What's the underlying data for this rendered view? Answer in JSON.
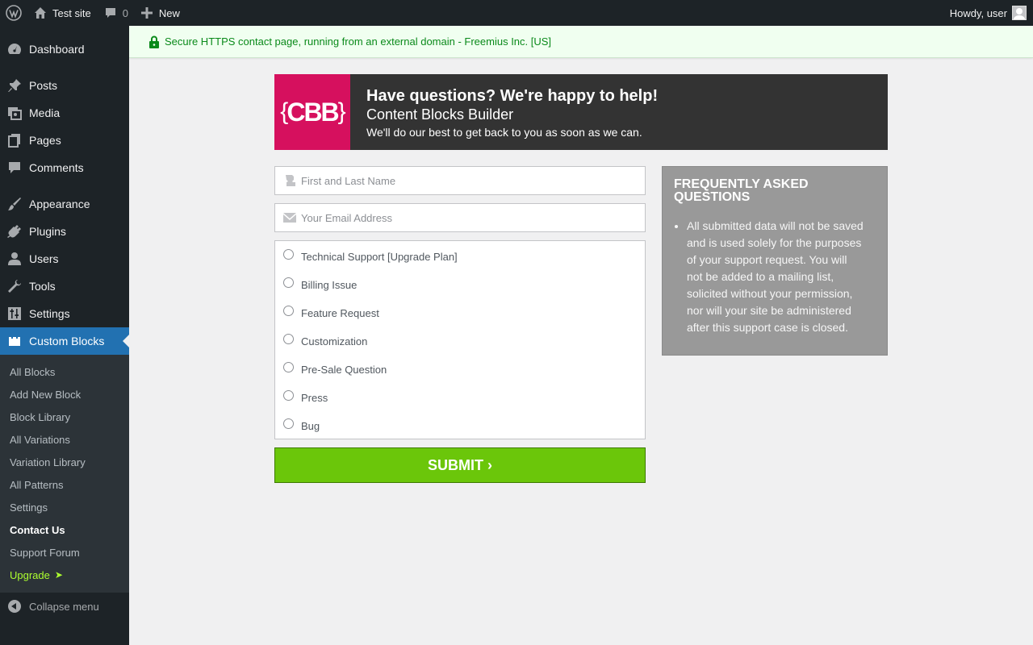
{
  "adminbar": {
    "site_name": "Test site",
    "comments_count": "0",
    "new_label": "New",
    "howdy": "Howdy, user"
  },
  "sidebar": {
    "items": [
      {
        "label": "Dashboard",
        "icon": "dashboard-icon"
      },
      {
        "label": "Posts",
        "icon": "pin-icon"
      },
      {
        "label": "Media",
        "icon": "media-icon"
      },
      {
        "label": "Pages",
        "icon": "pages-icon"
      },
      {
        "label": "Comments",
        "icon": "comment-icon"
      },
      {
        "label": "Appearance",
        "icon": "brush-icon"
      },
      {
        "label": "Plugins",
        "icon": "plug-icon"
      },
      {
        "label": "Users",
        "icon": "user-icon"
      },
      {
        "label": "Tools",
        "icon": "wrench-icon"
      },
      {
        "label": "Settings",
        "icon": "sliders-icon"
      },
      {
        "label": "Custom Blocks",
        "icon": "blocks-icon"
      }
    ],
    "submenu": [
      "All Blocks",
      "Add New Block",
      "Block Library",
      "All Variations",
      "Variation Library",
      "All Patterns",
      "Settings",
      "Contact Us",
      "Support Forum",
      "Upgrade"
    ],
    "upgrade_arrow": "➤",
    "collapse": "Collapse menu"
  },
  "notice": {
    "text": "Secure HTTPS contact page, running from an external domain - Freemius Inc. [US]"
  },
  "banner": {
    "logo_text": "CBB",
    "title": "Have questions? We're happy to help!",
    "subtitle": "Content Blocks Builder",
    "note": "We'll do our best to get back to you as soon as we can."
  },
  "form": {
    "name_placeholder": "First and Last Name",
    "email_placeholder": "Your Email Address",
    "options": [
      "Technical Support [Upgrade Plan]",
      "Billing Issue",
      "Feature Request",
      "Customization",
      "Pre-Sale Question",
      "Press",
      "Bug"
    ],
    "submit": "SUBMIT ›"
  },
  "faq": {
    "title": "Frequently Asked Questions",
    "items": [
      "All submitted data will not be saved and is used solely for the purposes of your support request. You will not be added to a mailing list, solicited without your permission, nor will your site be administered after this support case is closed."
    ]
  },
  "colors": {
    "accent": "#2271b1",
    "logo_bg": "#d6105e",
    "submit_bg": "#6bc60a",
    "upgrade": "#adff2f"
  }
}
